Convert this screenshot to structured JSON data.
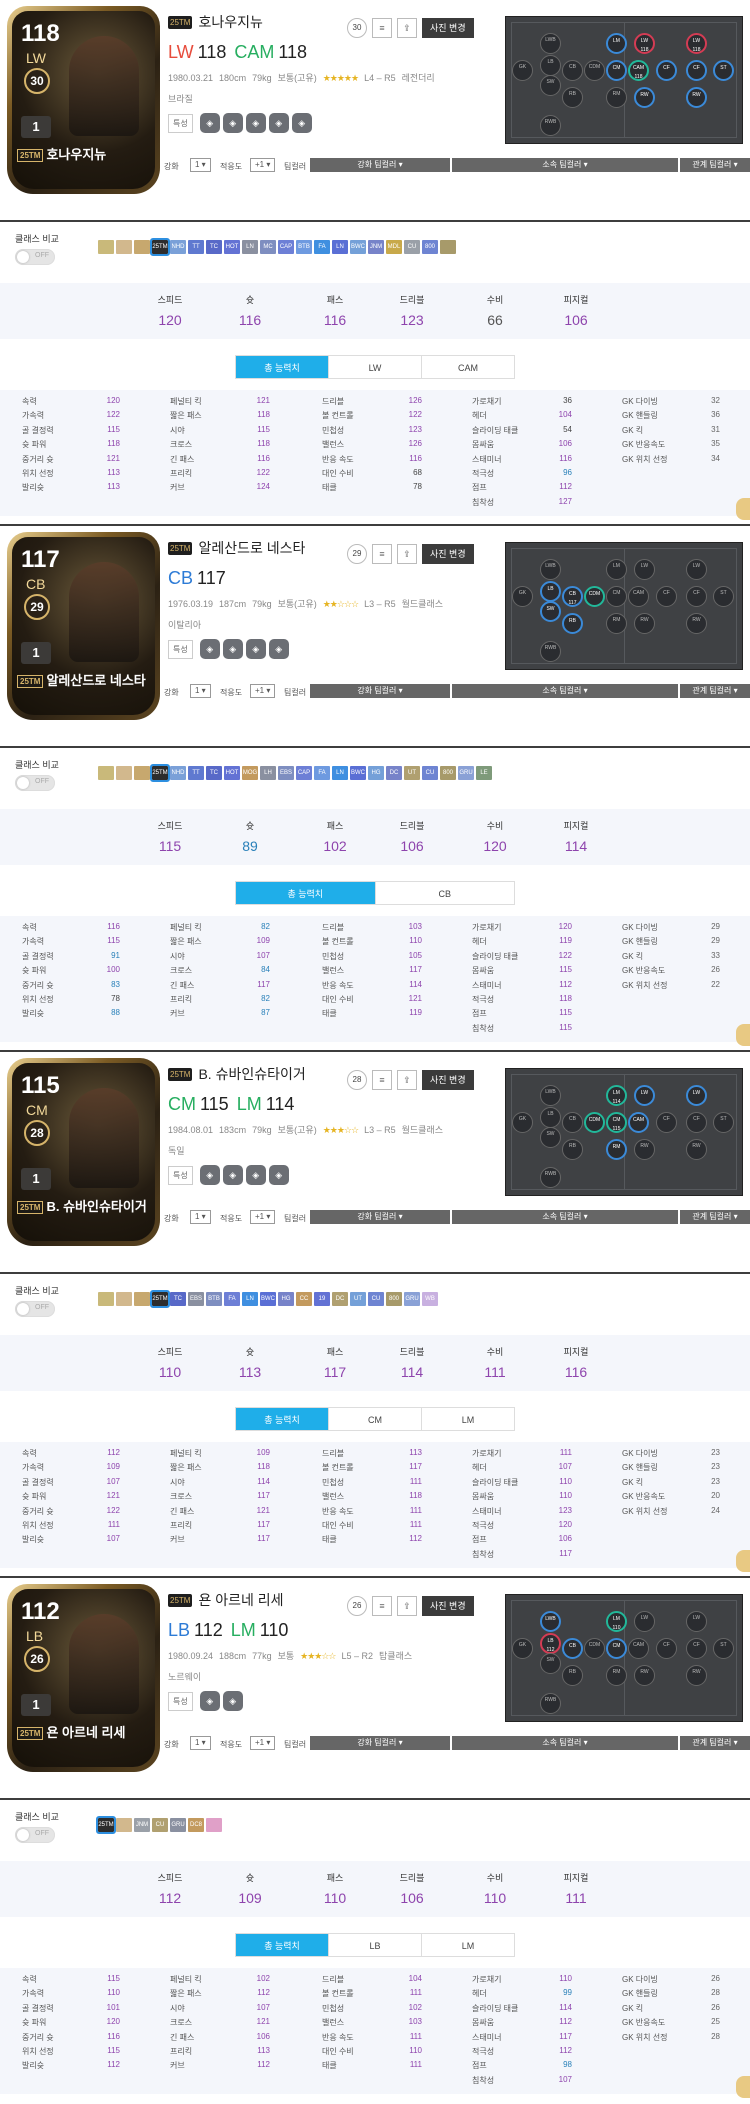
{
  "common": {
    "feature_label": "특성",
    "photo_button": "사진 변경",
    "compare_title": "클래스 비교",
    "toggle_off": "OFF",
    "enhance_label": "강화",
    "enhance_value": "1",
    "apply_label": "적응도",
    "apply_value": "+1",
    "teamcolor_label": "팀컬러",
    "bar_enhance": "강화 팀컬러",
    "bar_affiliation": "소속 팀컬러",
    "bar_relation": "관계 팀컬러",
    "total_tab": "총 능력치",
    "season_badge": "25TM",
    "summary_keys": [
      "스피드",
      "슛",
      "패스",
      "드리블",
      "수비",
      "피지컬"
    ],
    "stat_keys_1": [
      "속력",
      "가속력",
      "골 결정력",
      "슛 파워",
      "중거리 슛",
      "위치 선정",
      "발리슛"
    ],
    "stat_keys_2": [
      "페널티 킥",
      "짧은 패스",
      "시야",
      "크로스",
      "긴 패스",
      "프리킥",
      "커브"
    ],
    "stat_keys_3": [
      "드리블",
      "볼 컨트롤",
      "민첩성",
      "밸런스",
      "반응 속도",
      "대인 수비",
      "태클"
    ],
    "stat_keys_4": [
      "가로채기",
      "헤더",
      "슬라이딩 태클",
      "몸싸움",
      "스태미너",
      "적극성",
      "점프",
      "침착성"
    ],
    "stat_keys_5": [
      "GK 다이빙",
      "GK 핸들링",
      "GK 킥",
      "GK 반응속도",
      "GK 위치 선정"
    ],
    "star_icon": "star-icon",
    "colors": {
      "accent": "#1faee9",
      "purple": "#8e44ad",
      "blue": "#2980b9",
      "pitch": "#3f4144"
    }
  },
  "players": [
    {
      "name": "호나우지뉴",
      "ovr": "118",
      "pos": "LW",
      "salary": "30",
      "level": "1",
      "positions": [
        {
          "p": "LW",
          "v": "118",
          "cls": "p1"
        },
        {
          "p": "CAM",
          "v": "118",
          "cls": "p2"
        }
      ],
      "birth": "1980.03.21",
      "height": "180cm",
      "weight": "79kg",
      "build": "보통(고유)",
      "stars": "★★★★★",
      "foot": "L4 – R5",
      "tag": "레전더리",
      "nation": "브라질",
      "traits": 5,
      "summary": [
        "120",
        "116",
        "116",
        "123",
        "66",
        "106"
      ],
      "summary_colors": [
        "#8e44ad",
        "#8e44ad",
        "#8e44ad",
        "#8e44ad",
        "#555",
        "#8e44ad"
      ],
      "tabs": [
        "총 능력치",
        "LW",
        "CAM"
      ],
      "col1": [
        "120",
        "122",
        "115",
        "118",
        "121",
        "113",
        "113"
      ],
      "col2": [
        "121",
        "118",
        "115",
        "118",
        "116",
        "122",
        "124"
      ],
      "col3": [
        "126",
        "122",
        "123",
        "126",
        "116",
        "68",
        "78"
      ],
      "col4": [
        "36",
        "104",
        "54",
        "106",
        "116",
        "96",
        "112",
        "127"
      ],
      "col5": [
        "32",
        "36",
        "31",
        "35",
        "34"
      ],
      "chips": [
        "#c9b97a",
        "#d2b88d",
        "#c7a86e",
        "#2d2d2d",
        "#7aa0d8",
        "#5f79d0",
        "#5869c8",
        "#6372d4",
        "#8a90a0",
        "#7e8ec0",
        "#6d7fd6",
        "#6e9ae0",
        "#3f8fe0",
        "#5a6fd5",
        "#74a0d8",
        "#7783c9",
        "#c8a94a",
        "#9aa0a8",
        "#6e84d2",
        "#a79a6a"
      ],
      "chip_labels": [
        "",
        "",
        "",
        "25TM",
        "NHD",
        "TT",
        "TC",
        "HOT",
        "LN",
        "MC",
        "CAP",
        "BTB",
        "FA",
        "LN",
        "BWC",
        "JNM",
        "MDL",
        "CU",
        "800",
        ""
      ]
    },
    {
      "name": "알레산드로 네스타",
      "ovr": "117",
      "pos": "CB",
      "salary": "29",
      "level": "1",
      "positions": [
        {
          "p": "CB",
          "v": "117",
          "cls": "p3"
        }
      ],
      "birth": "1976.03.19",
      "height": "187cm",
      "weight": "79kg",
      "build": "보통(고유)",
      "stars": "★★☆☆☆",
      "foot": "L3 – R5",
      "tag": "월드클래스",
      "nation": "이탈리아",
      "traits": 4,
      "summary": [
        "115",
        "89",
        "102",
        "106",
        "120",
        "114"
      ],
      "summary_colors": [
        "#8e44ad",
        "#2980b9",
        "#8e44ad",
        "#8e44ad",
        "#8e44ad",
        "#8e44ad"
      ],
      "tabs": [
        "총 능력치",
        "CB"
      ],
      "col1": [
        "116",
        "115",
        "91",
        "100",
        "83",
        "78",
        "88"
      ],
      "col2": [
        "82",
        "109",
        "107",
        "84",
        "117",
        "82",
        "87"
      ],
      "col3": [
        "103",
        "110",
        "105",
        "117",
        "114",
        "121",
        "119"
      ],
      "col4": [
        "120",
        "119",
        "122",
        "115",
        "112",
        "118",
        "115",
        "115"
      ],
      "col5": [
        "29",
        "29",
        "33",
        "26",
        "22"
      ],
      "chips": [
        "#c9b97a",
        "#d2b88d",
        "#c7a86e",
        "#2d2d2d",
        "#7aa0d8",
        "#5f79d0",
        "#5869c8",
        "#6372d4",
        "#c39a5e",
        "#8a90a0",
        "#7e8ec0",
        "#6d7fd6",
        "#6e9ae0",
        "#3f8fe0",
        "#5a6fd5",
        "#74a0d8",
        "#7783c9",
        "#b0a070",
        "#6e84d2",
        "#a79a6a",
        "#8aa1d6",
        "#7e9a7a"
      ],
      "chip_labels": [
        "",
        "",
        "",
        "25TM",
        "NHD",
        "TT",
        "TC",
        "HOT",
        "MOG",
        "LH",
        "EBS",
        "CAP",
        "FA",
        "LN",
        "BWC",
        "HG",
        "DC",
        "UT",
        "CU",
        "800",
        "GRU",
        "LE"
      ]
    },
    {
      "name": "B. 슈바인슈타이거",
      "ovr": "115",
      "pos": "CM",
      "salary": "28",
      "level": "1",
      "positions": [
        {
          "p": "CM",
          "v": "115",
          "cls": "p2"
        },
        {
          "p": "LM",
          "v": "114",
          "cls": "p2"
        }
      ],
      "birth": "1984.08.01",
      "height": "183cm",
      "weight": "79kg",
      "build": "보통(고유)",
      "stars": "★★★☆☆",
      "foot": "L3 – R5",
      "tag": "월드클래스",
      "nation": "독일",
      "traits": 4,
      "summary": [
        "110",
        "113",
        "117",
        "114",
        "111",
        "116"
      ],
      "summary_colors": [
        "#8e44ad",
        "#8e44ad",
        "#8e44ad",
        "#8e44ad",
        "#8e44ad",
        "#8e44ad"
      ],
      "tabs": [
        "총 능력치",
        "CM",
        "LM"
      ],
      "col1": [
        "112",
        "109",
        "107",
        "121",
        "122",
        "111",
        "107"
      ],
      "col2": [
        "109",
        "118",
        "114",
        "117",
        "121",
        "117",
        "117"
      ],
      "col3": [
        "113",
        "117",
        "111",
        "118",
        "111",
        "111",
        "112"
      ],
      "col4": [
        "111",
        "107",
        "110",
        "110",
        "123",
        "120",
        "106",
        "117"
      ],
      "col5": [
        "23",
        "23",
        "23",
        "20",
        "24"
      ],
      "chips": [
        "#c9b97a",
        "#d2b88d",
        "#c7a86e",
        "#2d2d2d",
        "#5869c8",
        "#8a90a0",
        "#7e8ec0",
        "#6d7fd6",
        "#3f8fe0",
        "#5a6fd5",
        "#7783c9",
        "#c39a5e",
        "#6372d4",
        "#b0a070",
        "#74a0d8",
        "#6e84d2",
        "#a79a6a",
        "#8aa1d6",
        "#c8b0e0"
      ],
      "chip_labels": [
        "",
        "",
        "",
        "25TM",
        "TC",
        "EBS",
        "BTB",
        "FA",
        "LN",
        "BWC",
        "HG",
        "CC",
        "19",
        "DC",
        "UT",
        "CU",
        "800",
        "GRU",
        "WB"
      ]
    },
    {
      "name": "욘 아르네 리세",
      "ovr": "112",
      "pos": "LB",
      "salary": "26",
      "level": "1",
      "positions": [
        {
          "p": "LB",
          "v": "112",
          "cls": "p3"
        },
        {
          "p": "LM",
          "v": "110",
          "cls": "p2"
        }
      ],
      "birth": "1980.09.24",
      "height": "188cm",
      "weight": "77kg",
      "build": "보통",
      "stars": "★★★☆☆",
      "foot": "L5 – R2",
      "tag": "탑클래스",
      "nation": "노르웨이",
      "traits": 2,
      "summary": [
        "112",
        "109",
        "110",
        "106",
        "110",
        "111"
      ],
      "summary_colors": [
        "#8e44ad",
        "#8e44ad",
        "#8e44ad",
        "#8e44ad",
        "#8e44ad",
        "#8e44ad"
      ],
      "tabs": [
        "총 능력치",
        "LB",
        "LM"
      ],
      "col1": [
        "115",
        "110",
        "101",
        "120",
        "116",
        "115",
        "112"
      ],
      "col2": [
        "102",
        "112",
        "107",
        "121",
        "106",
        "113",
        "112"
      ],
      "col3": [
        "104",
        "111",
        "102",
        "103",
        "111",
        "110",
        "111"
      ],
      "col4": [
        "110",
        "99",
        "114",
        "112",
        "117",
        "112",
        "98",
        "107"
      ],
      "col5": [
        "26",
        "28",
        "26",
        "25",
        "28"
      ],
      "chips": [
        "#2d2d2d",
        "#d2b88d",
        "#9aa0a8",
        "#b0a070",
        "#8a90a0",
        "#c39a5e",
        "#e0a0c8"
      ],
      "chip_labels": [
        "25TM",
        "",
        "JNM",
        "CU",
        "GRU",
        "DC8",
        ""
      ]
    }
  ]
}
